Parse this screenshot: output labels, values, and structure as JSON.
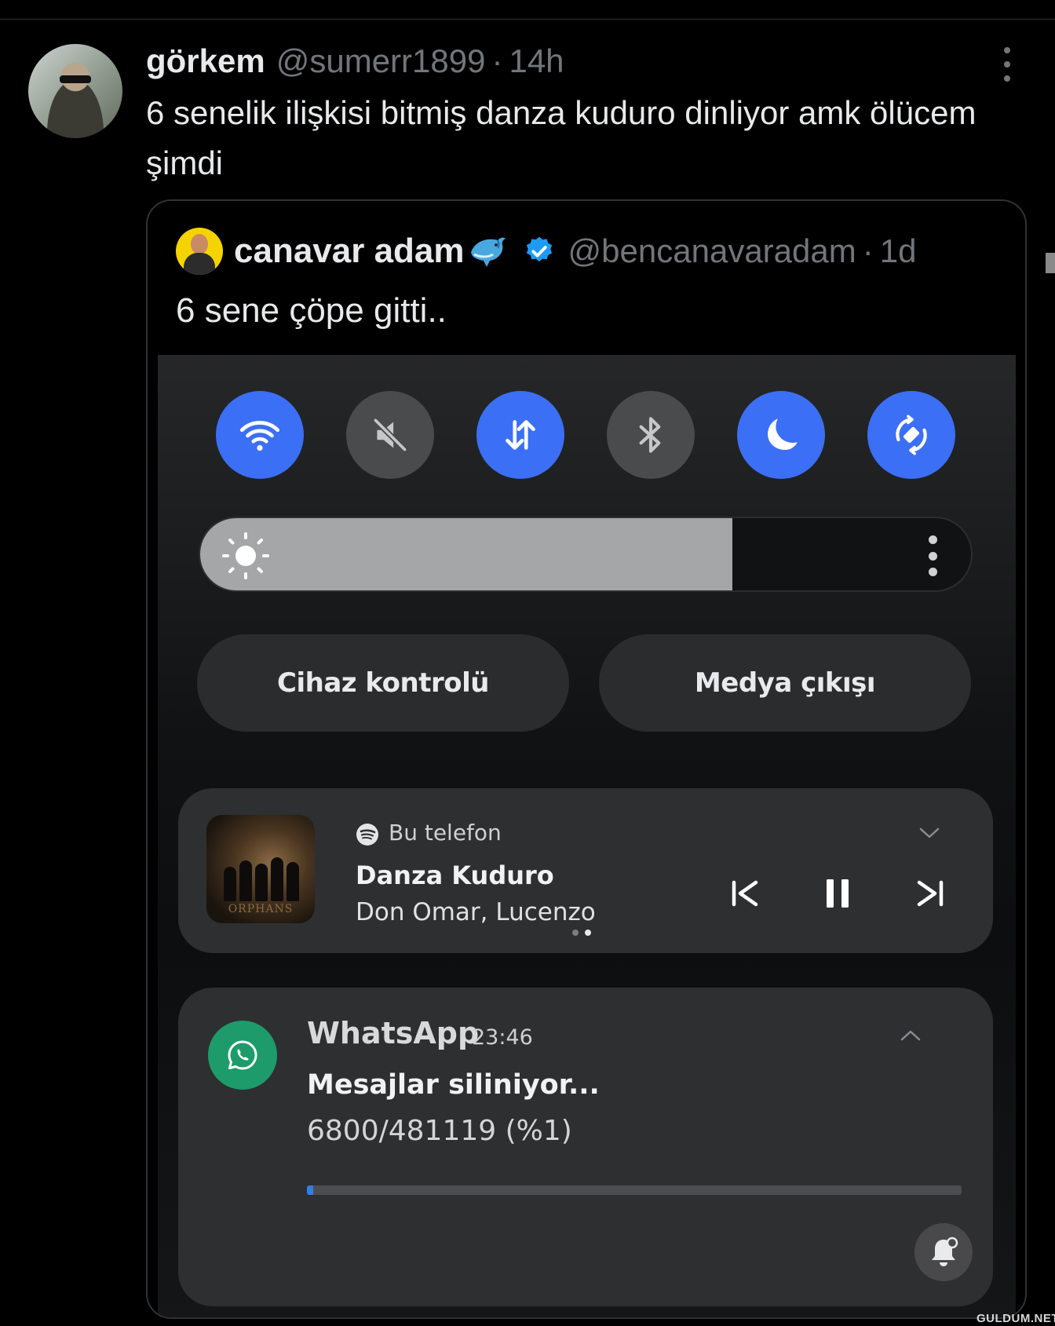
{
  "tweet": {
    "display_name": "görkem",
    "handle": "@sumerr1899",
    "separator": "·",
    "time": "14h",
    "text": "6 senelik ilişkisi bitmiş danza kuduro dinliyor amk ölücem şimdi"
  },
  "quoted": {
    "display_name": "canavar adam",
    "emoji": "dolphin-icon",
    "verified": true,
    "handle": "@bencanavaradam",
    "separator": "·",
    "time": "1d",
    "text": "6 sene çöpe gitti..",
    "phone": {
      "quick_settings": [
        {
          "icon": "wifi-icon",
          "state": "on"
        },
        {
          "icon": "mute-icon",
          "state": "off"
        },
        {
          "icon": "mobile-data-icon",
          "state": "on"
        },
        {
          "icon": "bluetooth-icon",
          "state": "off"
        },
        {
          "icon": "dark-mode-icon",
          "state": "on"
        },
        {
          "icon": "auto-rotate-icon",
          "state": "on"
        }
      ],
      "brightness_level": 0.69,
      "buttons": {
        "device_control": "Cihaz kontrolü",
        "media_output": "Medya çıkışı"
      },
      "media": {
        "source": "Bu telefon",
        "title": "Danza Kuduro",
        "artist": "Don Omar, Lucenzo",
        "album_label": "ORPHANS",
        "page_count": 2,
        "active_page": 2
      },
      "whatsapp": {
        "app": "WhatsApp",
        "time": "23:46",
        "title": "Mesajlar siliniyor...",
        "progress_text": "6800/481119 (%1)",
        "progress": 0.01
      }
    }
  },
  "colors": {
    "background": "#000000",
    "toggle_on": "#3b6ff5",
    "toggle_off": "#4a4b4d",
    "whatsapp_green": "#1e9b6a",
    "progress_blue": "#2f7df0",
    "verified_blue": "#1d9bf0"
  },
  "watermark": "GULDUM.NET"
}
